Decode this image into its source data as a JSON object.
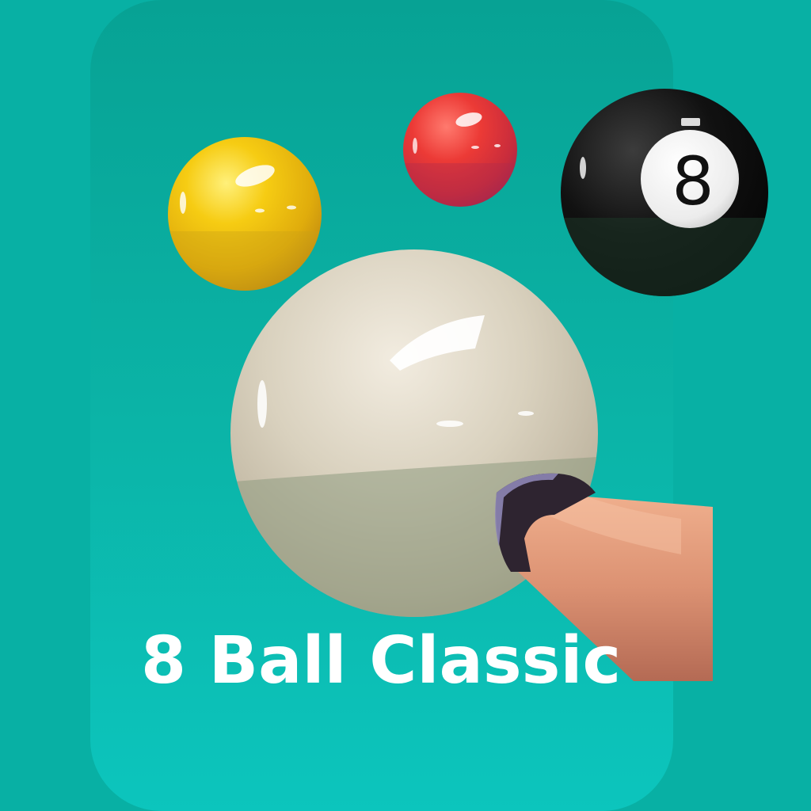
{
  "app": {
    "title": "8 Ball Classic"
  },
  "balls": [
    {
      "name": "yellow-ball",
      "color": "#f2c40e"
    },
    {
      "name": "red-ball",
      "color": "#e0323b"
    },
    {
      "name": "eight-ball",
      "color": "#0d0d0d",
      "number": "8"
    },
    {
      "name": "cue-ball",
      "color": "#ddd6c4"
    }
  ],
  "colors": {
    "background": "#08b0a4",
    "card_top": "#07a294",
    "card_bottom": "#0cc5bd",
    "title": "#ffffff",
    "cue_stick": "#d89070",
    "cue_tip": "#3a2c34"
  }
}
